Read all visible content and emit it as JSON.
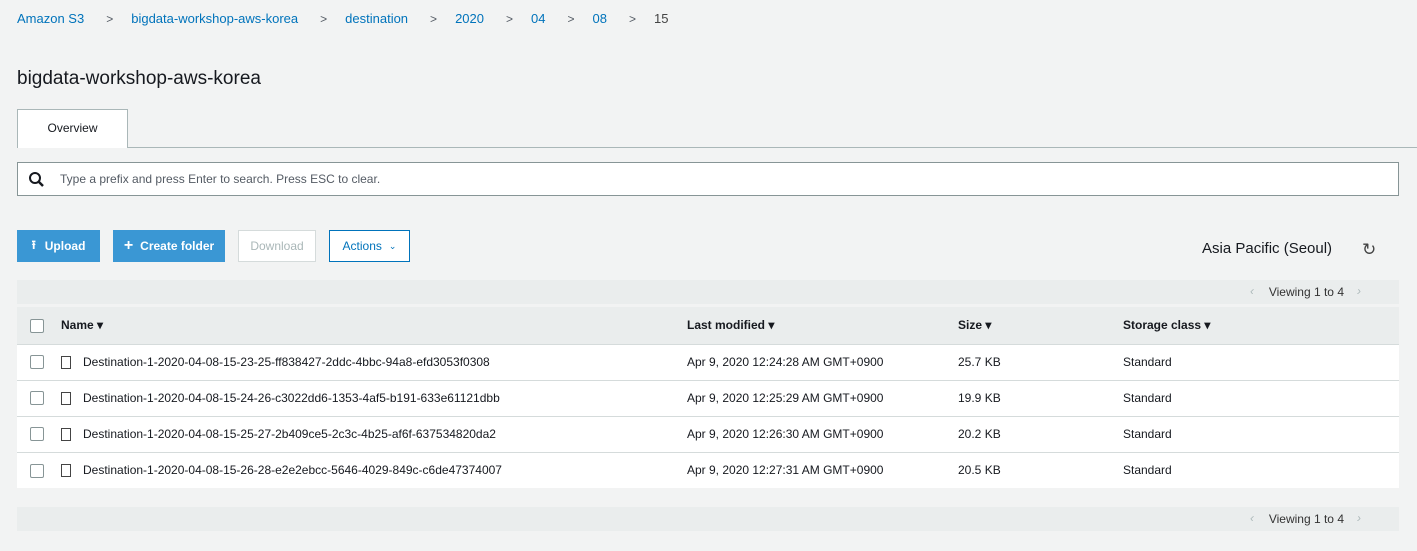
{
  "breadcrumb": [
    "Amazon S3",
    "bigdata-workshop-aws-korea",
    "destination",
    "2020",
    "04",
    "08"
  ],
  "breadcrumb_current": "15",
  "page_title": "bigdata-workshop-aws-korea",
  "tab": "Overview",
  "search_placeholder": "Type a prefix and press Enter to search. Press ESC to clear.",
  "toolbar": {
    "upload": "Upload",
    "create_folder": "Create folder",
    "download": "Download",
    "actions": "Actions"
  },
  "region": "Asia Pacific (Seoul)",
  "viewing": "Viewing 1 to 4",
  "columns": {
    "name": "Name",
    "modified": "Last modified",
    "size": "Size",
    "storage": "Storage class"
  },
  "rows": [
    {
      "name": "Destination-1-2020-04-08-15-23-25-ff838427-2ddc-4bbc-94a8-efd3053f0308",
      "modified": "Apr 9, 2020 12:24:28 AM GMT+0900",
      "size": "25.7 KB",
      "storage": "Standard"
    },
    {
      "name": "Destination-1-2020-04-08-15-24-26-c3022dd6-1353-4af5-b191-633e61121dbb",
      "modified": "Apr 9, 2020 12:25:29 AM GMT+0900",
      "size": "19.9 KB",
      "storage": "Standard"
    },
    {
      "name": "Destination-1-2020-04-08-15-25-27-2b409ce5-2c3c-4b25-af6f-637534820da2",
      "modified": "Apr 9, 2020 12:26:30 AM GMT+0900",
      "size": "20.2 KB",
      "storage": "Standard"
    },
    {
      "name": "Destination-1-2020-04-08-15-26-28-e2e2ebcc-5646-4029-849c-c6de47374007",
      "modified": "Apr 9, 2020 12:27:31 AM GMT+0900",
      "size": "20.5 KB",
      "storage": "Standard"
    }
  ]
}
